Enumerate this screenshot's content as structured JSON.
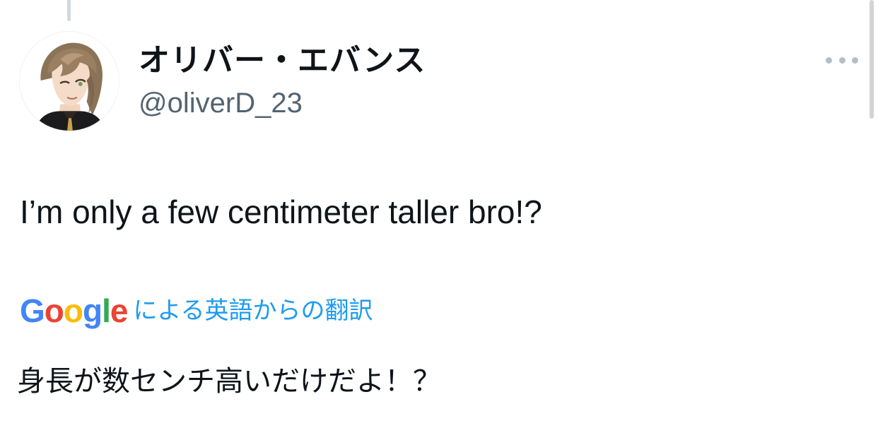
{
  "tweet": {
    "display_name": "オリバー・エバンス",
    "handle": "@oliverD_23",
    "text": "I’m only a few centimeter taller bro!?"
  },
  "translation": {
    "provider_logo": {
      "letters": [
        "G",
        "o",
        "o",
        "g",
        "l",
        "e"
      ]
    },
    "label": "による英語からの翻訳",
    "text": "身長が数センチ高いだけだよ！？"
  },
  "icons": {
    "more": "more-horizontal-icon",
    "avatar": "avatar-image"
  },
  "colors": {
    "text_primary": "#0f1419",
    "text_secondary": "#536471",
    "link": "#1d9bf0",
    "google_blue": "#4285f4",
    "google_red": "#ea4335",
    "google_yellow": "#fbbc05",
    "google_green": "#34a853"
  }
}
